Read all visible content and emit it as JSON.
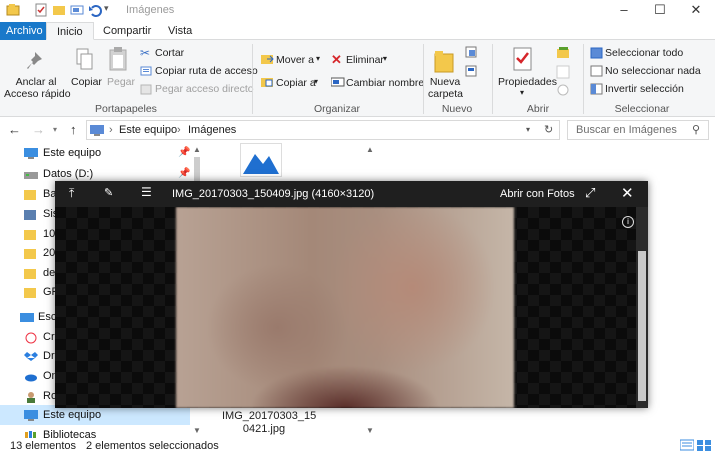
{
  "window": {
    "title": "Imágenes",
    "controls": [
      "minimize",
      "maximize",
      "close"
    ]
  },
  "ribbon_tabs": [
    "Archivo",
    "Inicio",
    "Compartir",
    "Vista"
  ],
  "ribbon": {
    "portapapeles": {
      "pin": "Anclar al\nAcceso rápido",
      "pin_l1": "Anclar al",
      "pin_l2": "Acceso rápido",
      "copy": "Copiar",
      "paste": "Pegar",
      "cut": "Cortar",
      "copy_path": "Copiar ruta de acceso",
      "paste_shortcut": "Pegar acceso directo",
      "group": "Portapapeles"
    },
    "organizar": {
      "move_to": "Mover a",
      "copy_to": "Copiar a",
      "delete": "Eliminar",
      "rename": "Cambiar nombre",
      "group": "Organizar"
    },
    "nuevo": {
      "new_folder_l1": "Nueva",
      "new_folder_l2": "carpeta",
      "group": "Nuevo"
    },
    "abrir": {
      "properties": "Propiedades",
      "group": "Abrir"
    },
    "seleccionar": {
      "select_all": "Seleccionar todo",
      "select_none": "No seleccionar nada",
      "invert": "Invertir selección",
      "group": "Seleccionar"
    }
  },
  "address": {
    "path": [
      "Este equipo",
      "Imágenes"
    ],
    "search_placeholder": "Buscar en Imágenes"
  },
  "nav_items": [
    {
      "label": "Este equipo",
      "icon": "monitor-icon"
    },
    {
      "label": "Datos (D:)",
      "icon": "drive-icon"
    },
    {
      "label": "Ba",
      "icon": "folder-icon"
    },
    {
      "label": "Sis",
      "icon": "folder-icon"
    },
    {
      "label": "10",
      "icon": "folder-icon"
    },
    {
      "label": "20",
      "icon": "folder-icon"
    },
    {
      "label": "de",
      "icon": "folder-icon"
    },
    {
      "label": "GR",
      "icon": "folder-icon"
    },
    {
      "label": "Escr",
      "icon": "desktop-icon"
    },
    {
      "label": "Cre",
      "icon": "creative-cloud-icon"
    },
    {
      "label": "Dro",
      "icon": "dropbox-icon"
    },
    {
      "label": "On",
      "icon": "onedrive-icon"
    },
    {
      "label": "Ro",
      "icon": "user-icon"
    },
    {
      "label": "Este equipo",
      "icon": "monitor-icon"
    },
    {
      "label": "Bibliotecas",
      "icon": "library-icon"
    }
  ],
  "file_item": {
    "name_l1": "IMG_20170303_15",
    "name_l2": "0421.jpg"
  },
  "viewer": {
    "filename": "IMG_20170303_150409.jpg (4160×3120)",
    "open_with": "Abrir con Fotos",
    "info_icon": "info-icon"
  },
  "status": {
    "count": "13 elementos",
    "selected": "2 elementos seleccionados"
  },
  "colors": {
    "accent": "#1979ca",
    "selected_nav": "#cce8ff"
  }
}
